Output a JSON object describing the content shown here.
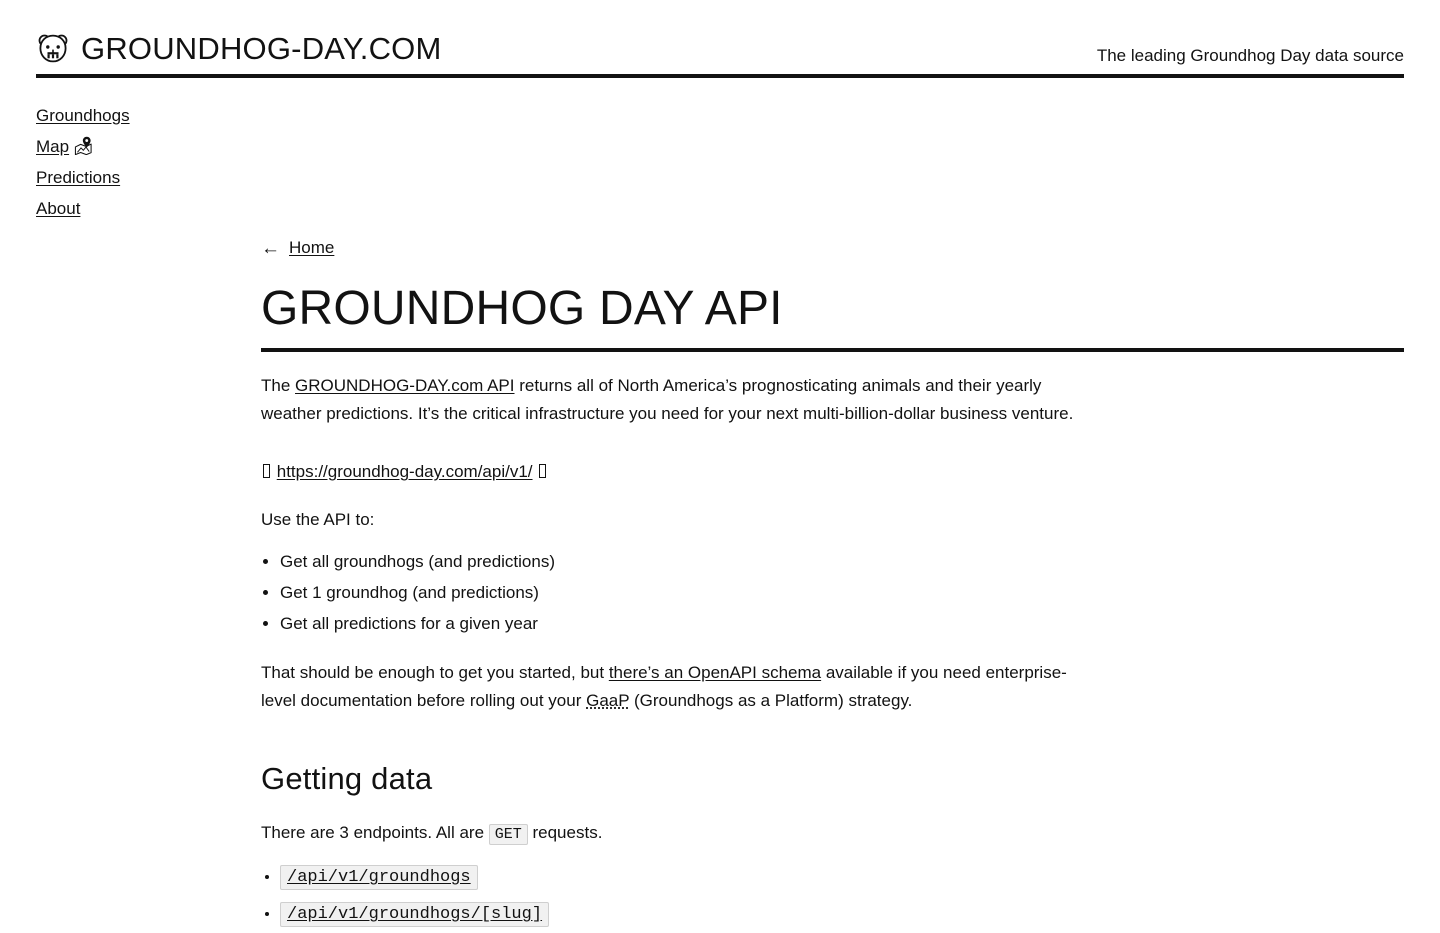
{
  "header": {
    "logo_icon": "groundhog-face-icon",
    "brand_title": "GROUNDHOG-DAY.COM",
    "tagline": "The leading Groundhog Day data source"
  },
  "sidebar": {
    "items": [
      {
        "label": "Groundhogs",
        "icon": ""
      },
      {
        "label": "Map",
        "icon": "map-icon"
      },
      {
        "label": "Predictions",
        "icon": ""
      },
      {
        "label": "About",
        "icon": ""
      }
    ]
  },
  "main": {
    "breadcrumb": {
      "arrow_icon": "arrow-left-icon",
      "arrow_glyph": "←",
      "label": "Home"
    },
    "page_title": "GROUNDHOG DAY API",
    "intro": {
      "before_link": "The ",
      "link_text": "GROUNDHOG-DAY.com API",
      "after_link": " returns all of North America’s prognosticating animals and their yearly weather predictions. It’s the critical infrastructure you need for your next multi-billion-dollar business venture."
    },
    "api_url": {
      "leading_glyph": "missing-glyph-box",
      "url": "https://groundhog-day.com/api/v1/",
      "trailing_glyph": "missing-glyph-box"
    },
    "use_intro": "Use the API to:",
    "use_list": [
      "Get all groundhogs (and predictions)",
      "Get 1 groundhog (and predictions)",
      "Get all predictions for a given year"
    ],
    "schema_note": {
      "part1": "That should be enough to get you started, but ",
      "link_text": "there’s an OpenAPI schema",
      "part2": " available if you need enterprise-level documentation before rolling out your ",
      "abbr": "GaaP",
      "part3": " (Groundhogs as a Platform) strategy."
    },
    "getting_data": {
      "heading": "Getting data",
      "intro_part1": "There are 3 endpoints. All are ",
      "method_badge": "GET",
      "intro_part2": " requests.",
      "endpoints": [
        "/api/v1/groundhogs",
        "/api/v1/groundhogs/[slug]"
      ]
    }
  },
  "colors": {
    "text": "#121212",
    "background": "#ffffff",
    "code_background": "#f1f1f1",
    "code_border": "#cfcfcf"
  }
}
